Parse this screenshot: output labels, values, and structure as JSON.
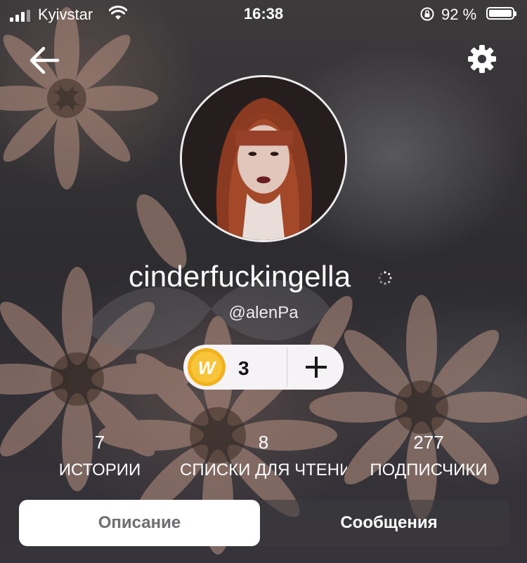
{
  "status_bar": {
    "carrier": "Kyivstar",
    "time": "16:38",
    "battery_percent": "92 %"
  },
  "profile": {
    "display_name": "cinderfuckingella",
    "handle": "@alenPa",
    "coins": "3"
  },
  "stats": [
    {
      "value": "7",
      "label": "ИСТОРИИ"
    },
    {
      "value": "8",
      "label": "СПИСКИ ДЛЯ ЧТЕНИЯ"
    },
    {
      "value": "277",
      "label": "ПОДПИСЧИКИ"
    }
  ],
  "tabs": {
    "description": "Описание",
    "messages": "Сообщения",
    "active": "description"
  },
  "icons": [
    "back-arrow-icon",
    "gear-icon",
    "coin-icon",
    "plus-icon",
    "loading-spinner-icon",
    "wifi-icon",
    "rotation-lock-icon",
    "battery-icon",
    "signal-icon"
  ],
  "colors": {
    "coin_gold": "#f3b21c",
    "tab_active_bg": "#ffffff",
    "tab_active_text": "#6e6e73"
  }
}
